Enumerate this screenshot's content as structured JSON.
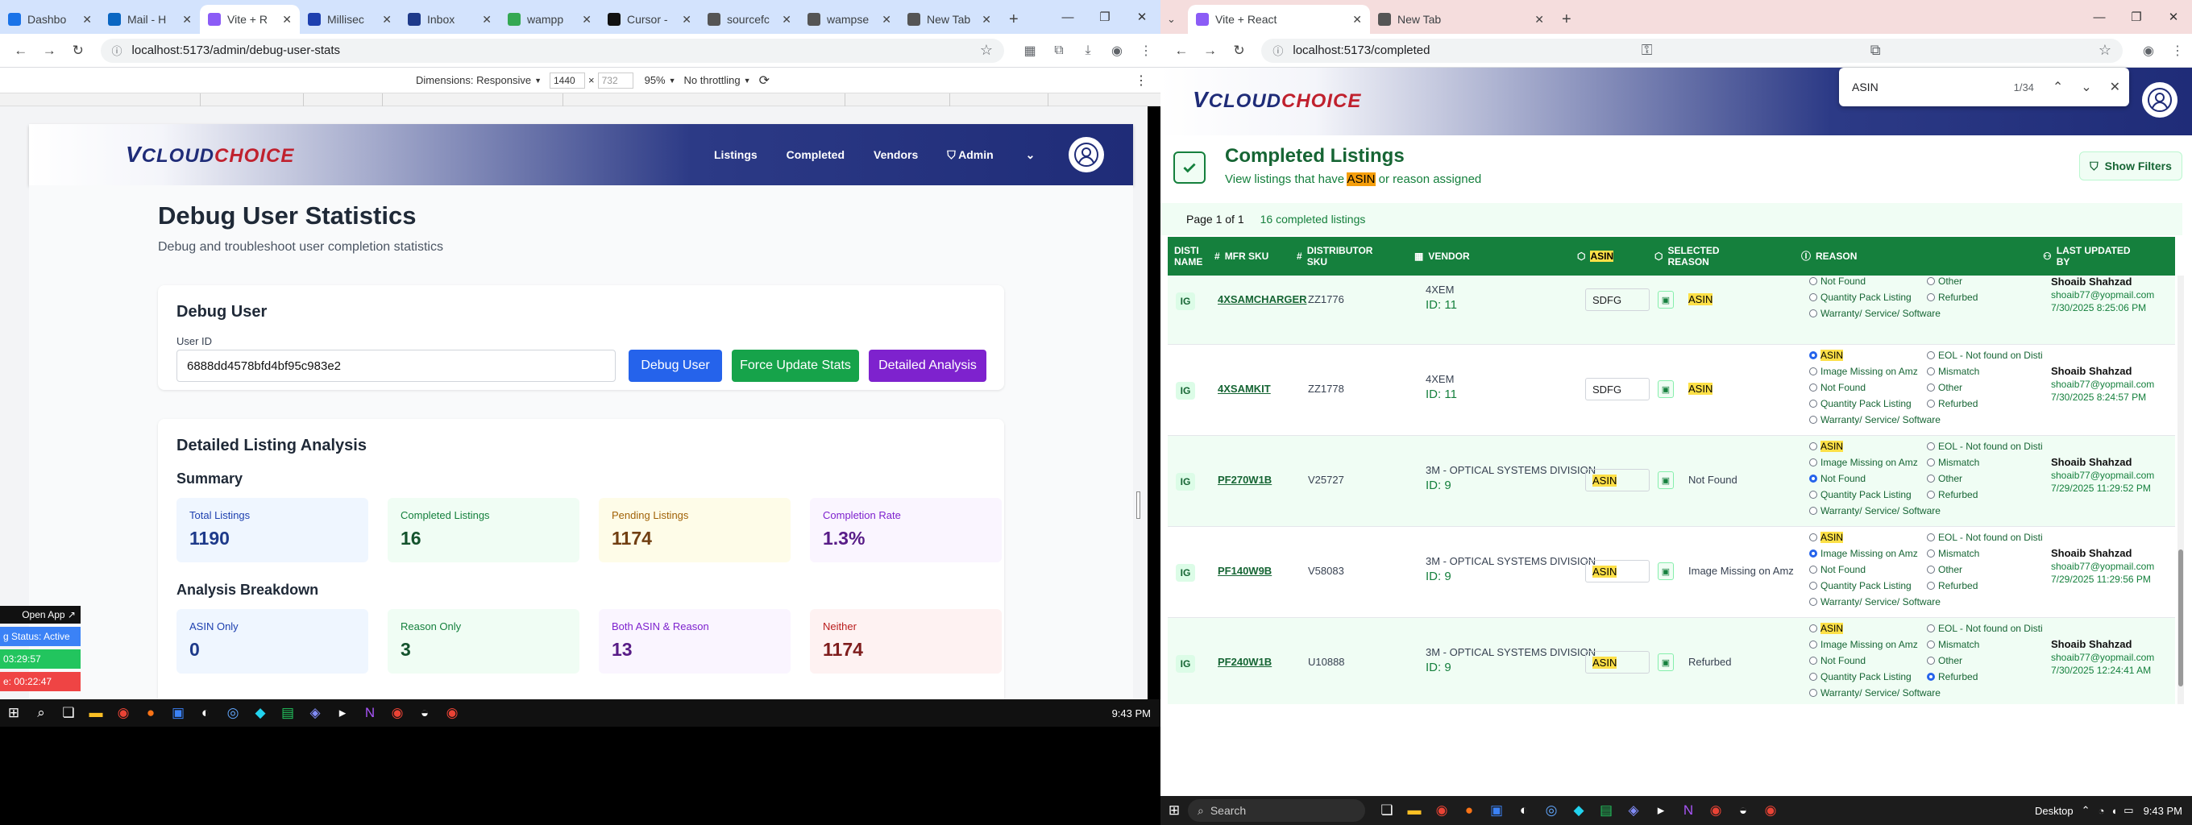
{
  "left_window": {
    "tabs": [
      {
        "label": "Dashbo",
        "color": "#1a73e8"
      },
      {
        "label": "Mail - H",
        "color": "#0a66c2"
      },
      {
        "label": "Vite + R",
        "color": "#8b5cf6",
        "active": true
      },
      {
        "label": "Millisec",
        "color": "#1e40af"
      },
      {
        "label": "Inbox",
        "color": "#1e3a8a"
      },
      {
        "label": "wampp",
        "color": "#34a853"
      },
      {
        "label": "Cursor -",
        "color": "#111"
      },
      {
        "label": "sourcefc",
        "color": "#555"
      },
      {
        "label": "wampse",
        "color": "#555"
      },
      {
        "label": "New Tab",
        "color": "#555"
      }
    ],
    "url": "localhost:5173/admin/debug-user-stats",
    "devtools": {
      "dimensions_label": "Dimensions: Responsive",
      "width": "1440",
      "height": "732",
      "zoom": "95%",
      "throttle": "No throttling"
    },
    "header": {
      "logo_v": "V",
      "logo_cloud": "CLOUD",
      "logo_choice": "CHOICE",
      "nav": [
        "Listings",
        "Completed",
        "Vendors"
      ],
      "admin": "Admin"
    },
    "page": {
      "title": "Debug User Statistics",
      "subtitle": "Debug and troubleshoot user completion statistics"
    },
    "debug_card": {
      "title": "Debug User",
      "user_id_label": "User ID",
      "user_id_value": "6888dd4578bfd4bf95c983e2",
      "btn_debug": "Debug User",
      "btn_force": "Force Update Stats",
      "btn_detailed": "Detailed Analysis"
    },
    "analysis": {
      "title": "Detailed Listing Analysis",
      "summary_title": "Summary",
      "summary": [
        {
          "label": "Total Listings",
          "value": "1190",
          "bg": "#eff6ff",
          "fg": "#1e40af",
          "vfg": "#1e3a8a"
        },
        {
          "label": "Completed Listings",
          "value": "16",
          "bg": "#f0fdf4",
          "fg": "#15803d",
          "vfg": "#14532d"
        },
        {
          "label": "Pending Listings",
          "value": "1174",
          "bg": "#fefce8",
          "fg": "#a16207",
          "vfg": "#713f12"
        },
        {
          "label": "Completion Rate",
          "value": "1.3%",
          "bg": "#faf5ff",
          "fg": "#7e22ce",
          "vfg": "#581c87"
        }
      ],
      "breakdown_title": "Analysis Breakdown",
      "breakdown": [
        {
          "label": "ASIN Only",
          "value": "0",
          "bg": "#eff6ff",
          "fg": "#1e40af",
          "vfg": "#1e3a8a"
        },
        {
          "label": "Reason Only",
          "value": "3",
          "bg": "#f0fdf4",
          "fg": "#15803d",
          "vfg": "#14532d"
        },
        {
          "label": "Both ASIN & Reason",
          "value": "13",
          "bg": "#faf5ff",
          "fg": "#7e22ce",
          "vfg": "#581c87"
        },
        {
          "label": "Neither",
          "value": "1174",
          "bg": "#fef2f2",
          "fg": "#b91c1c",
          "vfg": "#7f1d1d"
        }
      ]
    },
    "overlay": {
      "open_app": "Open App ↗",
      "status": "g Status: Active",
      "time1": "03:29:57",
      "time2": "e: 00:22:47"
    },
    "clock": "9:43 PM"
  },
  "right_window": {
    "tabs": [
      {
        "label": "Vite + React",
        "color": "#8b5cf6",
        "active": true
      },
      {
        "label": "New Tab",
        "color": "#555"
      }
    ],
    "url": "localhost:5173/completed",
    "find": {
      "query": "ASIN",
      "count": "1/34"
    },
    "header": {
      "logo_v": "V",
      "logo_cloud": "CLOUD",
      "logo_choice": "CHOICE"
    },
    "page": {
      "title": "Completed Listings",
      "subtitle_pre": "View listings that have ",
      "subtitle_hl": "ASIN",
      "subtitle_post": " or reason assigned",
      "show_filters": "Show Filters",
      "page_info": "Page 1 of 1",
      "count_info": "16 completed listings"
    },
    "columns": [
      "Disti Name",
      "MFR SKU",
      "Distributor SKU",
      "Vendor",
      "ASIN",
      "Selected Reason",
      "Reason",
      "Last Updated By"
    ],
    "reason_options_left": [
      "ASIN",
      "Image Missing on Amz",
      "Not Found",
      "Quantity Pack Listing",
      "Warranty/ Service/ Software"
    ],
    "reason_options_right": [
      "EOL - Not found on Disti",
      "Mismatch",
      "Other",
      "Refurbed"
    ],
    "rows": [
      {
        "disti": "IG",
        "mfr": "4XSAMCHARGER",
        "dsku": "ZZ1776",
        "vendor": "4XEM",
        "vid": "ID: 11",
        "asin": "SDFG",
        "selected": "ASIN",
        "sel_hl": true,
        "checked": "",
        "user": "Shoaib Shahzad",
        "email": "shoaib77@yopmail.com",
        "date": "7/30/2025 8:25:06 PM"
      },
      {
        "disti": "IG",
        "mfr": "4XSAMKIT",
        "dsku": "ZZ1778",
        "vendor": "4XEM",
        "vid": "ID: 11",
        "asin": "SDFG",
        "selected": "ASIN",
        "sel_hl": true,
        "checked": "ASIN",
        "user": "Shoaib Shahzad",
        "email": "shoaib77@yopmail.com",
        "date": "7/30/2025 8:24:57 PM"
      },
      {
        "disti": "IG",
        "mfr": "PF270W1B",
        "dsku": "V25727",
        "vendor": "3M - OPTICAL SYSTEMS DIVISION",
        "vid": "ID: 9",
        "asin": "ASIN",
        "selected": "Not Found",
        "sel_hl": false,
        "checked": "Not Found",
        "user": "Shoaib Shahzad",
        "email": "shoaib77@yopmail.com",
        "date": "7/29/2025 11:29:52 PM"
      },
      {
        "disti": "IG",
        "mfr": "PF140W9B",
        "dsku": "V58083",
        "vendor": "3M - OPTICAL SYSTEMS DIVISION",
        "vid": "ID: 9",
        "asin": "ASIN",
        "selected": "Image Missing on Amz",
        "sel_hl": false,
        "checked": "Image Missing on Amz",
        "user": "Shoaib Shahzad",
        "email": "shoaib77@yopmail.com",
        "date": "7/29/2025 11:29:56 PM"
      },
      {
        "disti": "IG",
        "mfr": "PF240W1B",
        "dsku": "U10888",
        "vendor": "3M - OPTICAL SYSTEMS DIVISION",
        "vid": "ID: 9",
        "asin": "ASIN",
        "selected": "Refurbed",
        "sel_hl": false,
        "checked": "Refurbed",
        "user": "Shoaib Shahzad",
        "email": "shoaib77@yopmail.com",
        "date": "7/30/2025 12:24:41 AM"
      }
    ],
    "taskbar": {
      "search": "Search",
      "desktop": "Desktop",
      "clock": "9:43 PM"
    }
  }
}
